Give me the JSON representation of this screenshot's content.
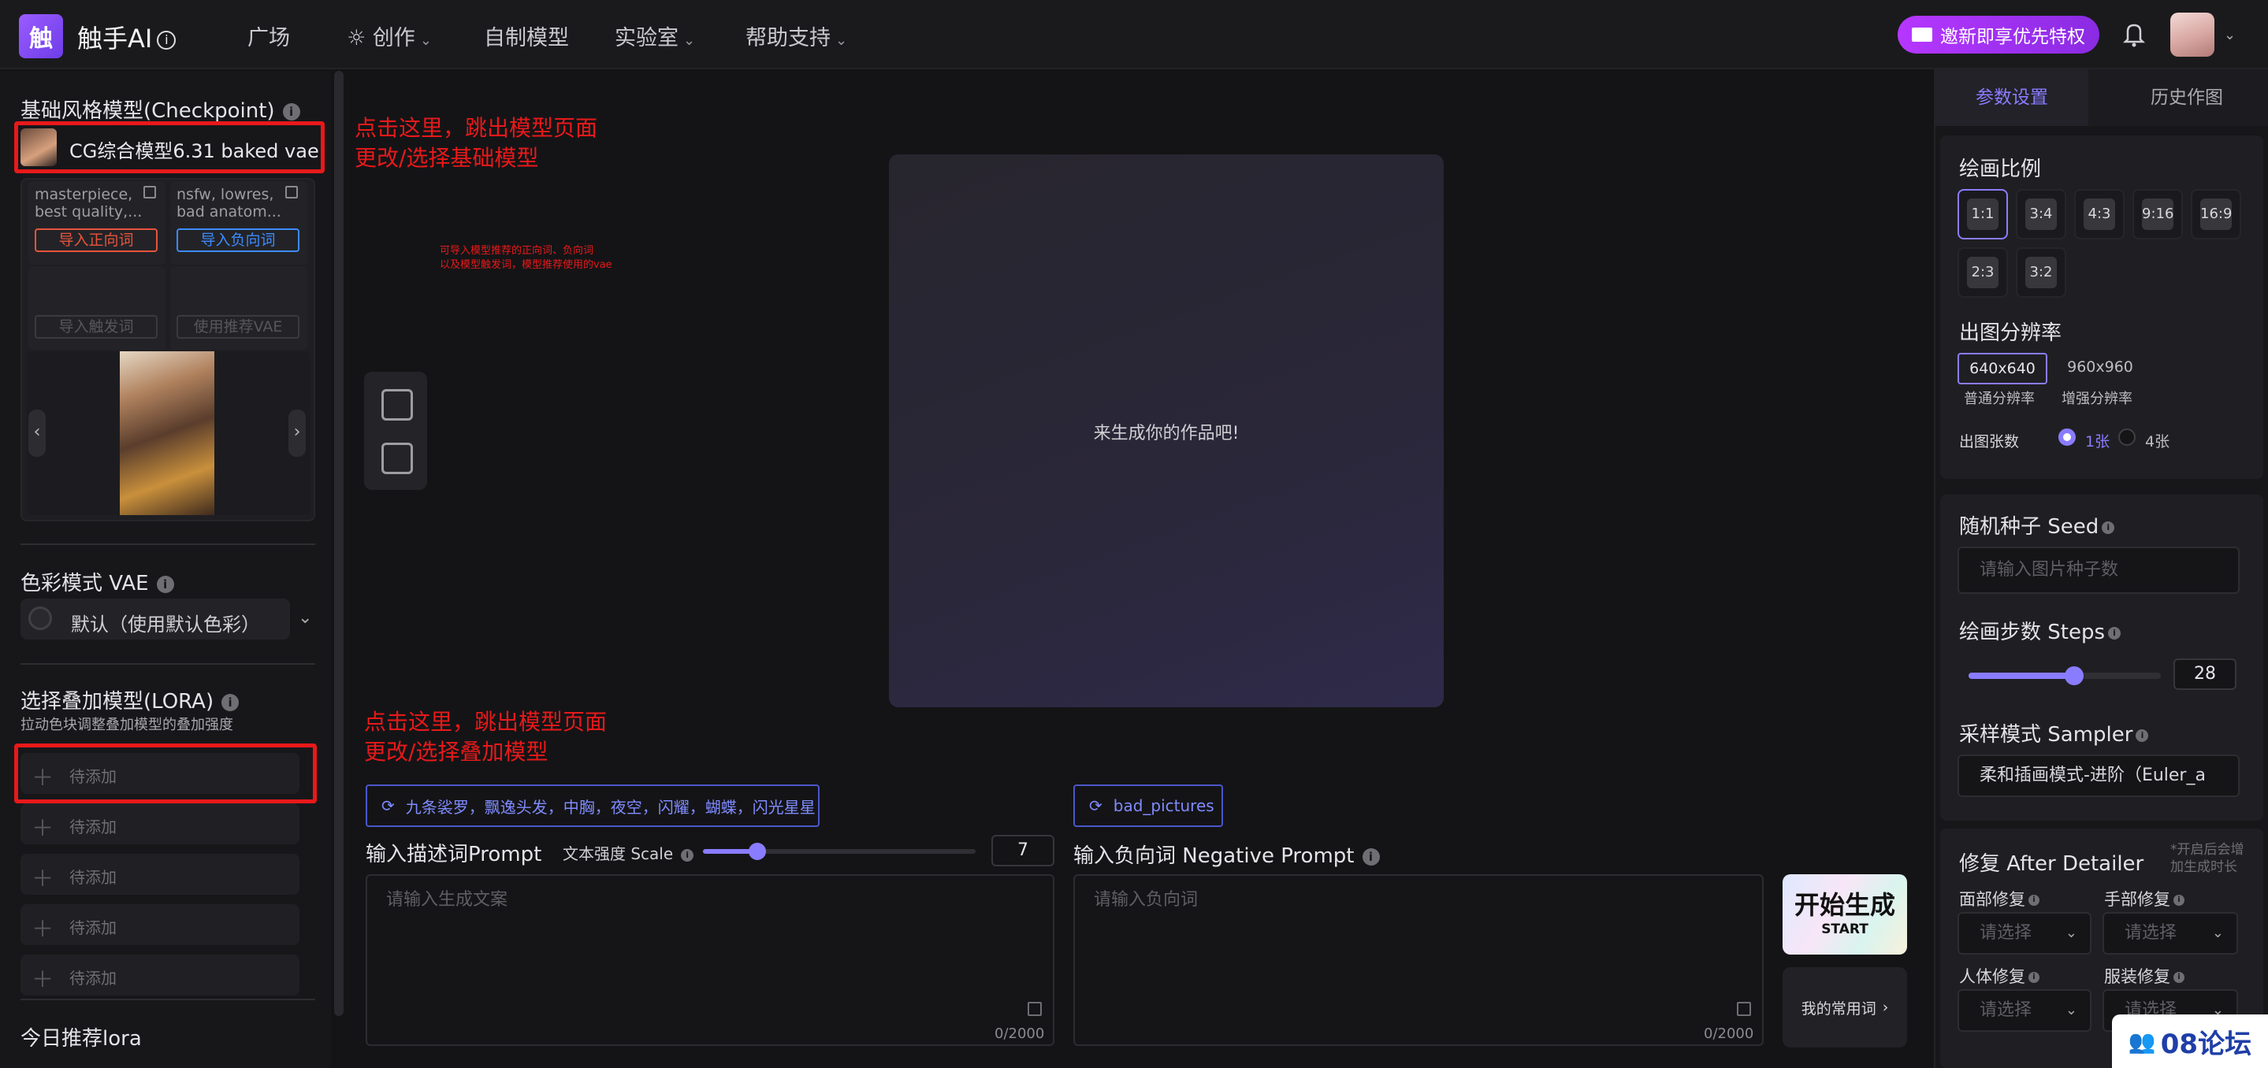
{
  "header": {
    "logo_glyph": "触",
    "app_name": "触手AI",
    "info_glyph": "i",
    "nav": [
      {
        "label": "广场"
      },
      {
        "label": "创作",
        "icon": "bulb-icon",
        "dropdown": true
      },
      {
        "label": "自制模型"
      },
      {
        "label": "实验室",
        "dropdown": true
      },
      {
        "label": "帮助支持",
        "dropdown": true
      }
    ],
    "invite_label": "邀新即享优先特权"
  },
  "left": {
    "checkpoint_title": "基础风格模型(Checkpoint)",
    "checkpoint_name": "CG综合模型6.31 baked vae",
    "positive_preview": "masterpiece, best quality,...",
    "negative_preview": "nsfw, lowres, bad anatom...",
    "import_positive": "导入正向词",
    "import_negative": "导入负向词",
    "import_trigger": "导入触发词",
    "use_vae": "使用推荐VAE",
    "vae_title": "色彩模式 VAE",
    "vae_value": "默认（使用默认色彩）",
    "lora_title": "选择叠加模型(LORA)",
    "lora_desc": "拉动色块调整叠加模型的叠加强度",
    "lora_slots": [
      "待添加",
      "待添加",
      "待添加",
      "待添加",
      "待添加"
    ],
    "today_title": "今日推荐lora"
  },
  "annotations": {
    "checkpoint_note_1": "点击这里，跳出模型页面",
    "checkpoint_note_2": "更改/选择基础模型",
    "small_note_1": "可导入模型推荐的正向词、负向词",
    "small_note_2": "以及模型触发词，模型推荐使用的vae",
    "lora_note_1": "点击这里，跳出模型页面",
    "lora_note_2": "更改/选择叠加模型"
  },
  "center": {
    "canvas_placeholder": "来生成你的作品吧!",
    "positive_tags": "九条裟罗，飘逸头发，中胸，夜空，闪耀，蝴蝶，闪光星星",
    "negative_tags": "bad_pictures",
    "prompt_label": "输入描述词Prompt",
    "scale_label": "文本强度 Scale",
    "scale_value": "7",
    "scale_fraction": 0.2,
    "prompt_placeholder": "请输入生成文案",
    "prompt_count": "0/2000",
    "negative_label": "输入负向词 Negative Prompt",
    "negative_placeholder": "请输入负向词",
    "negative_count": "0/2000",
    "start_main": "开始生成",
    "start_sub": "START",
    "favorites_label": "我的常用词"
  },
  "right": {
    "tabs": [
      "参数设置",
      "历史作图"
    ],
    "ratio_title": "绘画比例",
    "ratios": [
      "1:1",
      "3:4",
      "4:3",
      "9:16",
      "16:9",
      "2:3",
      "3:2"
    ],
    "resolution_title": "出图分辨率",
    "resolutions": [
      {
        "value": "640x640",
        "desc": "普通分辨率"
      },
      {
        "value": "960x960",
        "desc": "增强分辨率"
      }
    ],
    "count_label": "出图张数",
    "count_options": [
      "1张",
      "4张"
    ],
    "seed_title": "随机种子 Seed",
    "seed_placeholder": "请输入图片种子数",
    "steps_title": "绘画步数 Steps",
    "steps_value": "28",
    "steps_fraction": 0.55,
    "sampler_title": "采样模式 Sampler",
    "sampler_value": "柔和插画模式-进阶（Euler_a",
    "fix_title": "修复 After Detailer",
    "fix_note": "*开启后会增加生成时长",
    "fix_items": [
      {
        "label": "面部修复",
        "placeholder": "请选择"
      },
      {
        "label": "手部修复",
        "placeholder": "请选择"
      },
      {
        "label": "人体修复",
        "placeholder": "请选择"
      },
      {
        "label": "服装修复",
        "placeholder": "请选择"
      }
    ]
  },
  "watermark": "08论坛",
  "colors": {
    "accent": "#8a7cff",
    "annotation_red": "#e8191a",
    "invite_gradient_start": "#b637ff",
    "positive_btn": "#e8543c",
    "negative_btn": "#3d8bff"
  }
}
